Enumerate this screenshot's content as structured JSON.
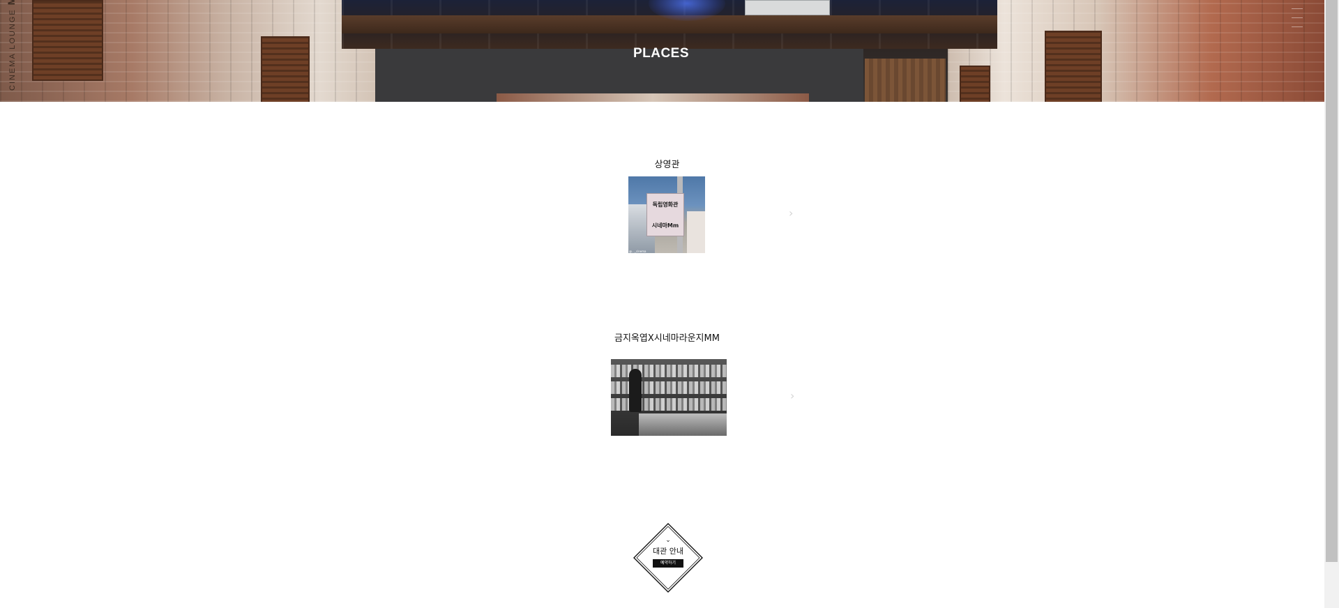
{
  "brand": {
    "text": "CINEMA LOUNGE",
    "mark": "MM"
  },
  "hero": {
    "title": "PLACES"
  },
  "places": [
    {
      "title": "상영관",
      "sign_lines": [
        "독립영화관",
        "시네마Mm"
      ],
      "caption": "@..._cinema"
    },
    {
      "title": "금지옥엽X시네마라운지MM"
    }
  ],
  "nav": {
    "next_glyph": "›"
  },
  "badge": {
    "down_glyph": "⌄",
    "label": "대관 안내",
    "button_label": "예약하기"
  },
  "colors": {
    "text": "#111111",
    "hero_title": "#ffffff",
    "chevron": "#d4d4d4"
  },
  "icons": [
    "menu-icon",
    "chevron-right-icon",
    "chevron-down-icon"
  ]
}
